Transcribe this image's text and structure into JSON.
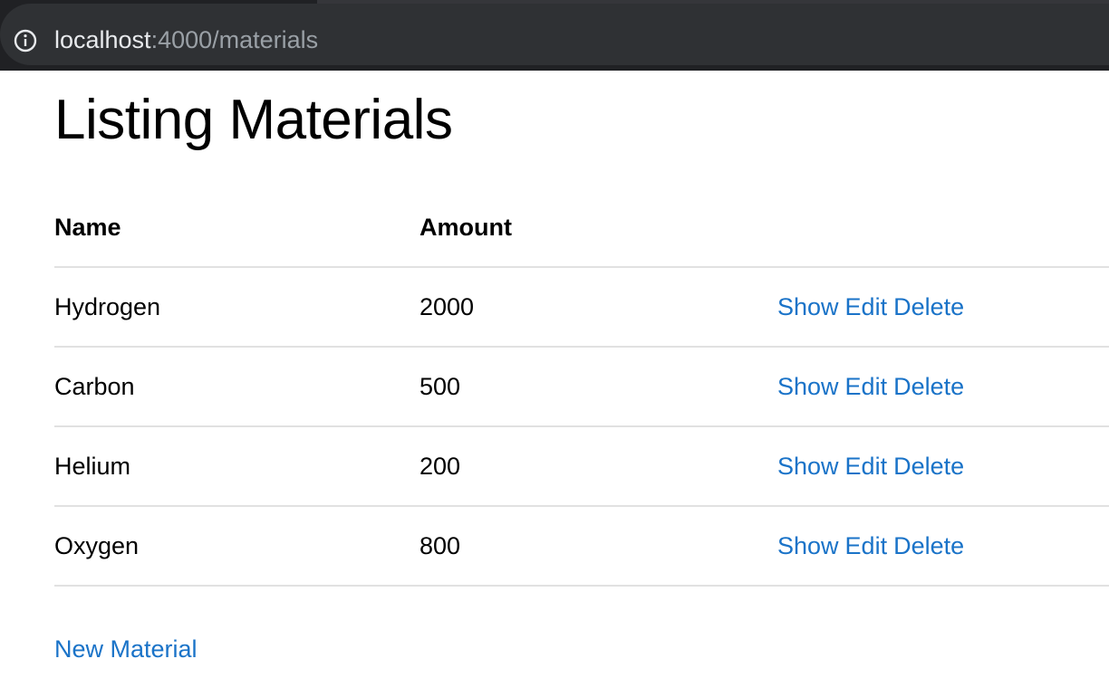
{
  "browser": {
    "url_host": "localhost",
    "url_rest": ":4000/materials",
    "info_icon": "info-icon"
  },
  "page": {
    "title": "Listing Materials",
    "link_color": "#1a73c8"
  },
  "table": {
    "headers": [
      "Name",
      "Amount",
      ""
    ],
    "rows": [
      {
        "name": "Hydrogen",
        "amount": "2000",
        "show": "Show",
        "edit": "Edit",
        "delete": "Delete"
      },
      {
        "name": "Carbon",
        "amount": "500",
        "show": "Show",
        "edit": "Edit",
        "delete": "Delete"
      },
      {
        "name": "Helium",
        "amount": "200",
        "show": "Show",
        "edit": "Edit",
        "delete": "Delete"
      },
      {
        "name": "Oxygen",
        "amount": "800",
        "show": "Show",
        "edit": "Edit",
        "delete": "Delete"
      }
    ]
  },
  "new_link": "New Material"
}
